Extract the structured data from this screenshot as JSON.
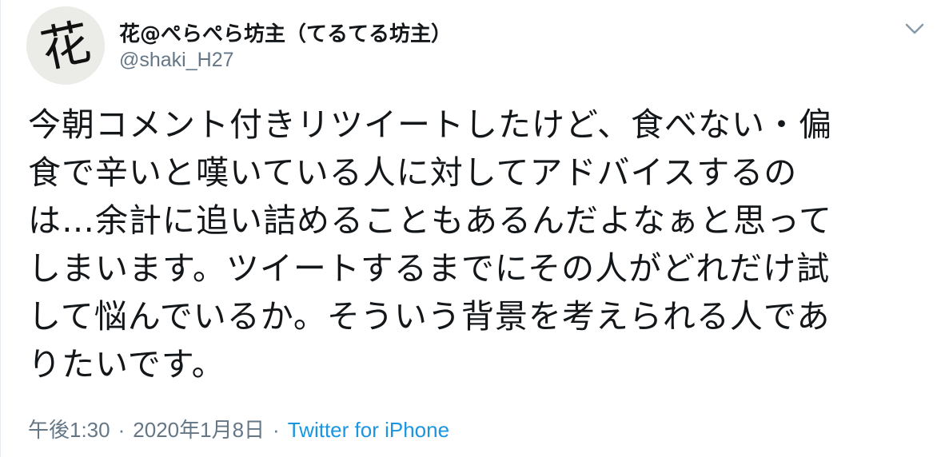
{
  "author": {
    "display_name": "花@ぺらぺら坊主（てるてる坊主）",
    "handle": "@shaki_H27",
    "avatar_glyph": "花"
  },
  "tweet": {
    "lines": [
      "今朝コメント付きリツイートしたけど、食べない・偏",
      "食で辛いと嘆いている人に対してアドバイスするの",
      "は…余計に追い詰めることもあるんだよなぁと思って",
      "しまいます。ツイートするまでにその人がどれだけ試",
      "して悩んでいるか。そういう背景を考えられる人であ",
      "りたいです。"
    ]
  },
  "meta": {
    "time": "午後1:30",
    "date": "2020年1月8日",
    "separator": "·",
    "source": "Twitter for iPhone"
  },
  "icons": {
    "caret": "chevron-down-icon"
  },
  "colors": {
    "text": "#14171a",
    "secondary": "#657786",
    "link": "#1b95e0"
  }
}
